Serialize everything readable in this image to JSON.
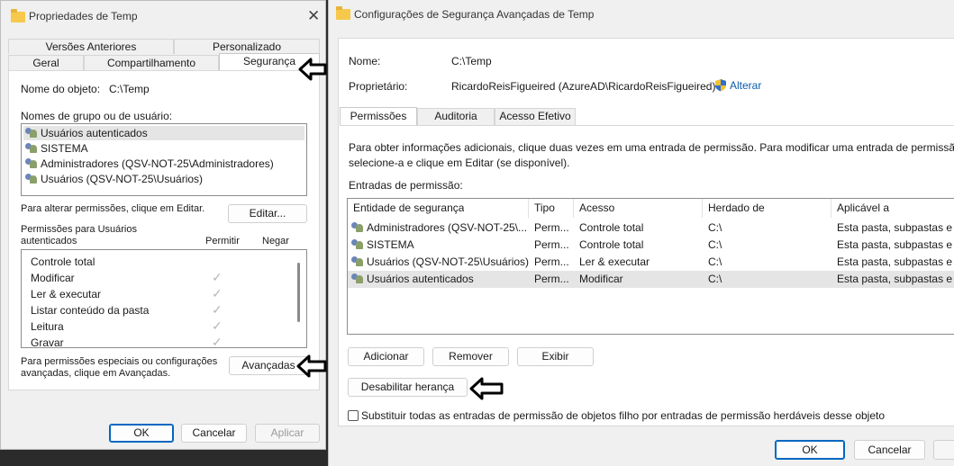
{
  "left_dialog": {
    "title": "Propriedades de Temp",
    "tabs_row1": [
      "Versões Anteriores",
      "Personalizado"
    ],
    "tabs_row2": [
      "Geral",
      "Compartilhamento",
      "Segurança"
    ],
    "object_name_label": "Nome do objeto:",
    "object_name_value": "C:\\Temp",
    "groups_label": "Nomes de grupo ou de usuário:",
    "groups": [
      "Usuários autenticados",
      "SISTEMA",
      "Administradores (QSV-NOT-25\\Administradores)",
      "Usuários (QSV-NOT-25\\Usuários)"
    ],
    "edit_hint": "Para alterar permissões, clique em Editar.",
    "edit_button": "Editar...",
    "permissions_for_line1": "Permissões para Usuários",
    "permissions_for_line2": "autenticados",
    "allow_header": "Permitir",
    "deny_header": "Negar",
    "permissions": [
      {
        "name": "Controle total",
        "allow": false
      },
      {
        "name": "Modificar",
        "allow": true
      },
      {
        "name": "Ler & executar",
        "allow": true
      },
      {
        "name": "Listar conteúdo da pasta",
        "allow": true
      },
      {
        "name": "Leitura",
        "allow": true
      },
      {
        "name": "Gravar",
        "allow": true
      }
    ],
    "advanced_hint_line1": "Para permissões especiais ou configurações",
    "advanced_hint_line2": "avançadas, clique em Avançadas.",
    "advanced_button": "Avançadas",
    "ok_button": "OK",
    "cancel_button": "Cancelar",
    "apply_button": "Aplicar"
  },
  "right_dialog": {
    "title": "Configurações de Segurança Avançadas de Temp",
    "name_label": "Nome:",
    "name_value": "C:\\Temp",
    "owner_label": "Proprietário:",
    "owner_value": "RicardoReisFigueired (AzureAD\\RicardoReisFigueired)",
    "change_link": "Alterar",
    "tabs": [
      "Permissões",
      "Auditoria",
      "Acesso Efetivo"
    ],
    "info_line1": "Para obter informações adicionais, clique duas vezes em uma entrada de permissão. Para modificar uma entrada de permissão,",
    "info_line2": "selecione-a e clique em Editar (se disponível).",
    "entries_label": "Entradas de permissão:",
    "columns": [
      "Entidade de segurança",
      "Tipo",
      "Acesso",
      "Herdado de",
      "Aplicável a"
    ],
    "rows": [
      {
        "principal": "Administradores (QSV-NOT-25\\...",
        "type": "Perm...",
        "access": "Controle total",
        "inherited": "C:\\",
        "applies": "Esta pasta, subpastas e arq"
      },
      {
        "principal": "SISTEMA",
        "type": "Perm...",
        "access": "Controle total",
        "inherited": "C:\\",
        "applies": "Esta pasta, subpastas e arq"
      },
      {
        "principal": "Usuários (QSV-NOT-25\\Usuários)",
        "type": "Perm...",
        "access": "Ler & executar",
        "inherited": "C:\\",
        "applies": "Esta pasta, subpastas e arq"
      },
      {
        "principal": "Usuários autenticados",
        "type": "Perm...",
        "access": "Modificar",
        "inherited": "C:\\",
        "applies": "Esta pasta, subpastas e arq"
      }
    ],
    "add_button": "Adicionar",
    "remove_button": "Remover",
    "view_button": "Exibir",
    "disable_inheritance_button": "Desabilitar herança",
    "replace_checkbox_label": "Substituir todas as entradas de permissão de objetos filho por entradas de permissão herdáveis desse objeto",
    "ok_button": "OK",
    "cancel_button": "Cancelar"
  },
  "colors": {
    "accent": "#0067c0",
    "link": "#0b5cab",
    "selection": "#e5e5e5",
    "folder": "#f6c94c"
  }
}
